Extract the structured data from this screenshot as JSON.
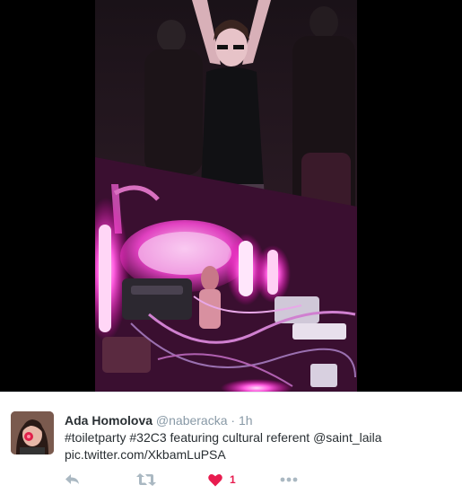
{
  "tweet": {
    "author_name": "Ada Homolova",
    "author_handle": "@naberacka",
    "separator": "·",
    "timestamp": "1h",
    "text_segments": {
      "hashtag1": "#toiletparty",
      "hashtag2": "#32C3",
      "middle": " featuring cultural referent ",
      "mention": "@saint_laila",
      "pic_link": "pic.twitter.com/XkbamLuPSA"
    },
    "actions": {
      "reply_icon": "reply-icon",
      "retweet_icon": "retweet-icon",
      "like_icon": "heart-icon",
      "like_count": "1",
      "more_icon": "more-icon"
    }
  },
  "colors": {
    "name_text": "#292f33",
    "muted_text": "#8899a6",
    "like_active": "#e81c4f",
    "action_icon": "#aab8c2",
    "photo_glow": "#ff3fd0"
  }
}
